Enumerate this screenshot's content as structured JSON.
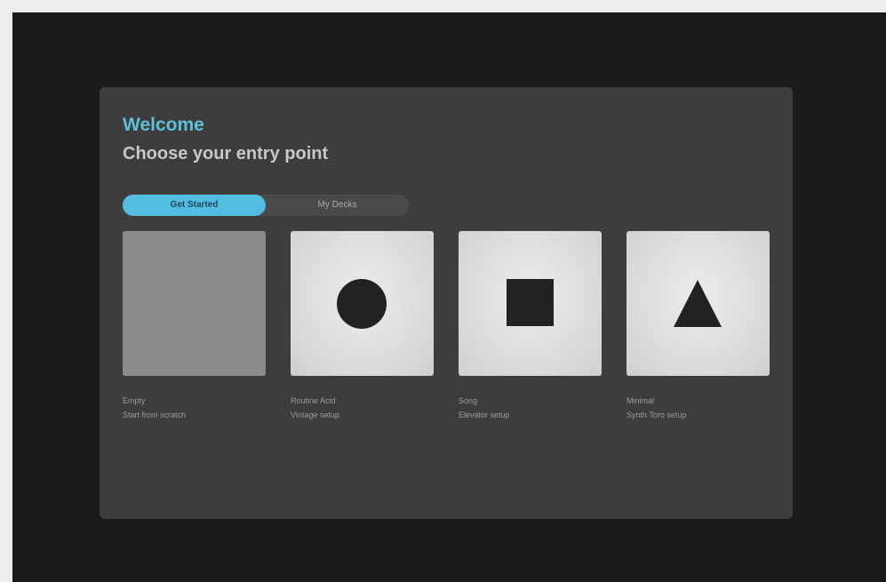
{
  "header": {
    "welcome": "Welcome",
    "subtitle": "Choose your entry point"
  },
  "tabs": [
    {
      "label": "Get Started",
      "active": true
    },
    {
      "label": "My Decks",
      "active": false
    }
  ],
  "cards": [
    {
      "icon": "blank",
      "title": "Empty",
      "description": "Start from scratch"
    },
    {
      "icon": "circle",
      "title": "Routine Acid",
      "description": "Vintage setup"
    },
    {
      "icon": "square",
      "title": "Song",
      "description": "Elevator setup"
    },
    {
      "icon": "triangle",
      "title": "Minimal",
      "description": "Synth Toro setup"
    }
  ],
  "colors": {
    "accent": "#52bde0",
    "welcome_text": "#5cc0da",
    "panel": "#3d3d3d",
    "background": "#1b1b1b"
  }
}
